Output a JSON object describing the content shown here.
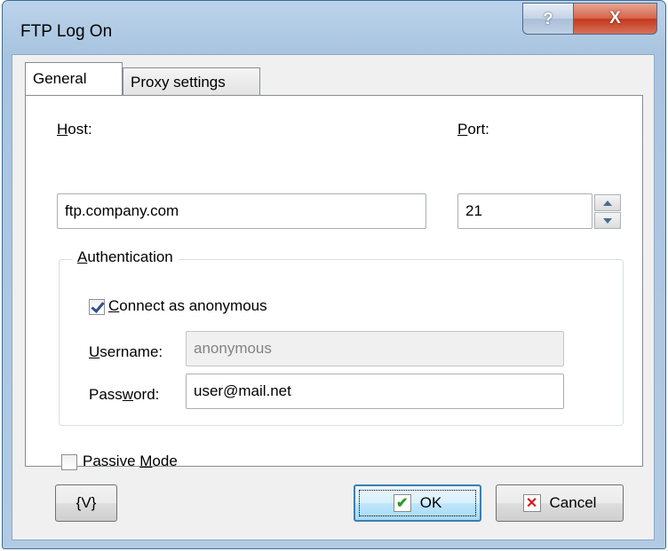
{
  "window": {
    "title": "FTP Log On"
  },
  "title_buttons": {
    "help": "?",
    "close": "X"
  },
  "tabs": [
    {
      "label": "General",
      "selected": true
    },
    {
      "label": "Proxy settings",
      "selected": false
    }
  ],
  "general": {
    "host_label_u": "H",
    "host_label_rest": "ost:",
    "host_value": "ftp.company.com",
    "port_label_u": "P",
    "port_label_rest": "ort:",
    "port_value": "21",
    "auth_group_u": "A",
    "auth_group_rest": "uthentication",
    "anon_u": "C",
    "anon_rest": "onnect as anonymous",
    "anon_checked": true,
    "username_label_u": "U",
    "username_label_rest": "sername:",
    "username_value": "anonymous",
    "password_label_pre": "Pass",
    "password_label_u": "w",
    "password_label_post": "ord:",
    "password_value": "user@mail.net",
    "passive_pre": "Passive ",
    "passive_u": "M",
    "passive_post": "ode",
    "passive_checked": false
  },
  "buttons": {
    "variables": "{V}",
    "ok": "OK",
    "cancel": "Cancel"
  },
  "colors": {
    "accent": "#3c7fb1",
    "ok_check": "#2a9a2a",
    "cancel_x": "#d42020"
  }
}
